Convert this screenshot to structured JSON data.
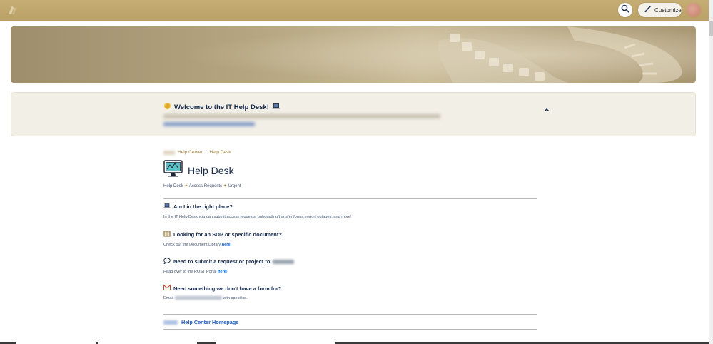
{
  "header": {
    "customize_label": "Customize"
  },
  "welcome": {
    "title": "Welcome to the IT Help Desk!"
  },
  "breadcrumb": {
    "items": [
      "Help Center",
      "Help Desk"
    ],
    "separator": "/"
  },
  "page": {
    "title": "Help Desk",
    "tags": [
      "Help Desk",
      "Access Requests",
      "Urgent"
    ],
    "tag_separator": "✦"
  },
  "sections": [
    {
      "heading": "Am I in the right place?",
      "icon": "laptop-icon",
      "body": "In the IT Help Desk you can submit access requests, onboarding/transfer forms, report outages, and more!"
    },
    {
      "heading": "Looking for an SOP or specific document?",
      "icon": "book-icon",
      "body_prefix": "Check out the Document Library",
      "link_label": "here!"
    },
    {
      "heading": "Need to submit a request or project to",
      "icon": "speech-bubble-icon",
      "body_prefix": "Head over to the RQST Portal",
      "link_label": "here!"
    },
    {
      "heading": "Need something we don't have a form for?",
      "icon": "envelope-icon",
      "body_prefix": "Email",
      "body_suffix": "with specifics."
    }
  ],
  "footer": {
    "link_label": "Help Center Homepage"
  },
  "colors": {
    "topbar": "#c2aa70",
    "welcome_bg": "#f2efe7",
    "link": "#0c66e4",
    "breadcrumb": "#a0823f"
  }
}
